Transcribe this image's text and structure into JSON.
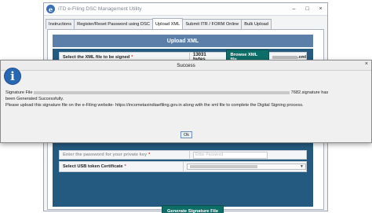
{
  "app": {
    "title": "ITD e-Filing DSC Management Utility",
    "icon_letter": "e",
    "controls": [
      "–",
      "□",
      "×"
    ]
  },
  "tabs": [
    {
      "label": "Instructions",
      "active": false
    },
    {
      "label": "Register/Reset Password using DSC",
      "active": false
    },
    {
      "label": "Upload XML",
      "active": true
    },
    {
      "label": "Submit ITR / FORM Online",
      "active": false
    },
    {
      "label": "Bulk Upload",
      "active": false
    }
  ],
  "upload": {
    "header": "Upload XML",
    "select_xml_label": "Select the XML file to be signed",
    "required_mark": "*",
    "file_size": "13031 bytes",
    "browse_button": "Browse XML file",
    "file_ext": ".xml",
    "password_label": "Enter the password for your private key",
    "password_placeholder": "Enter Password",
    "usb_label": "Select USB token Certificate",
    "generate_button": "Generate Signature File"
  },
  "dialog": {
    "title": "Success",
    "close": "×",
    "line1_prefix": "Signature File",
    "line1_suffix": "7682.signature has",
    "line2": "been Generated Successfully.",
    "line3": " Please upload this signature file on the e-Filing website- https://incometaxindiaefiling.gov.in  along with the xml file to complete the Digital Signing process.",
    "ok_button": "Ok"
  },
  "colors": {
    "header_blue": "#5b7fa8",
    "frame_blue": "#245a7f",
    "button_teal": "#0d6e68",
    "info_blue": "#2767b4",
    "required_red": "#c0392b"
  }
}
